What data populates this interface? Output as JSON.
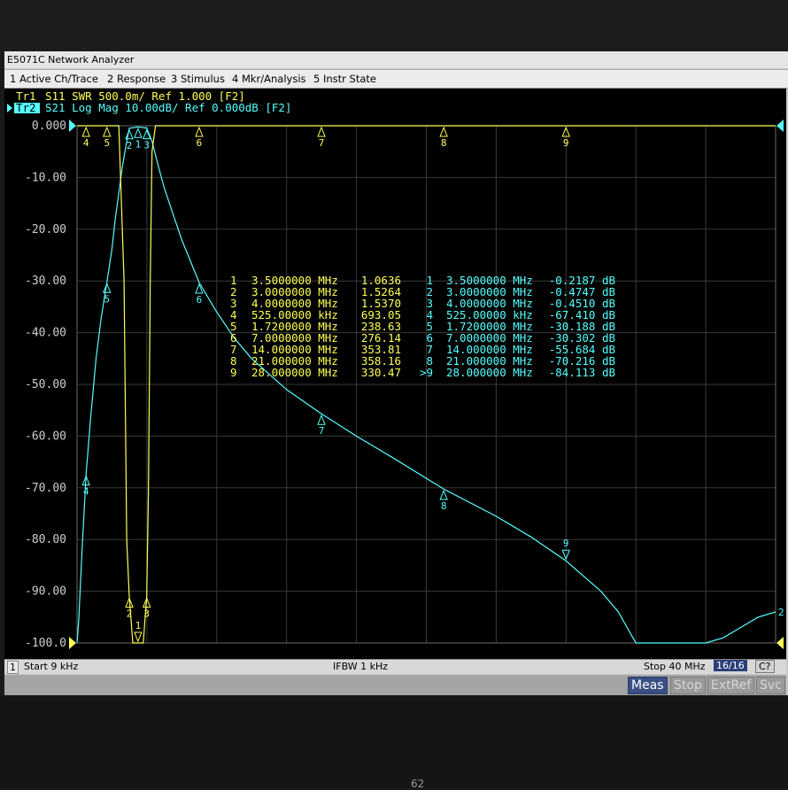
{
  "window": {
    "title": "E5071C Network Analyzer"
  },
  "menu": [
    {
      "label": "1 Active Ch/Trace"
    },
    {
      "label": "2 Response"
    },
    {
      "label": "3 Stimulus"
    },
    {
      "label": "4 Mkr/Analysis"
    },
    {
      "label": "5 Instr State"
    }
  ],
  "traces": [
    {
      "id": "Tr1",
      "text": "S11  SWR 500.0m/ Ref 1.000 [F2]",
      "color": "#ffff55",
      "active": false
    },
    {
      "id": "Tr2",
      "text": "S21  Log Mag 10.00dB/ Ref 0.000dB [F2]",
      "color": "#55ffff",
      "active": true
    }
  ],
  "axis": {
    "y_ticks": [
      "0.000",
      "-10.00",
      "-20.00",
      "-30.00",
      "-40.00",
      "-50.00",
      "-60.00",
      "-70.00",
      "-80.00",
      "-90.00",
      "-100.0"
    ]
  },
  "markers": {
    "s11": [
      {
        "n": "1",
        "freq": "3.5000000 MHz",
        "value": "1.0636"
      },
      {
        "n": "2",
        "freq": "3.0000000 MHz",
        "value": "1.5264"
      },
      {
        "n": "3",
        "freq": "4.0000000 MHz",
        "value": "1.5370"
      },
      {
        "n": "4",
        "freq": "525.00000 kHz",
        "value": "693.05"
      },
      {
        "n": "5",
        "freq": "1.7200000 MHz",
        "value": "238.63"
      },
      {
        "n": "6",
        "freq": "7.0000000 MHz",
        "value": "276.14"
      },
      {
        "n": "7",
        "freq": "14.000000 MHz",
        "value": "353.81"
      },
      {
        "n": "8",
        "freq": "21.000000 MHz",
        "value": "358.16"
      },
      {
        "n": "9",
        "freq": "28.000000 MHz",
        "value": "330.47"
      }
    ],
    "s21": [
      {
        "n": "1",
        "freq": "3.5000000 MHz",
        "value": "-0.2187 dB"
      },
      {
        "n": "2",
        "freq": "3.0000000 MHz",
        "value": "-0.4747 dB"
      },
      {
        "n": "3",
        "freq": "4.0000000 MHz",
        "value": "-0.4510 dB"
      },
      {
        "n": "4",
        "freq": "525.00000 kHz",
        "value": "-67.410 dB"
      },
      {
        "n": "5",
        "freq": "1.7200000 MHz",
        "value": "-30.188 dB"
      },
      {
        "n": "6",
        "freq": "7.0000000 MHz",
        "value": "-30.302 dB"
      },
      {
        "n": "7",
        "freq": "14.000000 MHz",
        "value": "-55.684 dB"
      },
      {
        "n": "8",
        "freq": "21.000000 MHz",
        "value": "-70.216 dB"
      },
      {
        "n": "9",
        "freq": "28.000000 MHz",
        "value": "-84.113 dB"
      }
    ],
    "active_prefix": ">"
  },
  "status": {
    "channel": "1",
    "start": "Start 9 kHz",
    "ifbw": "IFBW 1 kHz",
    "stop": "Stop 40 MHz",
    "count": "16/16",
    "mode": "C?"
  },
  "softkeys": [
    {
      "label": "Meas",
      "active": true
    },
    {
      "label": "Stop",
      "active": false
    },
    {
      "label": "ExtRef",
      "active": false
    },
    {
      "label": "Svc",
      "active": false
    }
  ],
  "photo": {
    "caption": "62"
  },
  "colors": {
    "trace_s11": "#ffff55",
    "trace_s21": "#55ffff",
    "grid": "#3a3a3a",
    "background": "#000000"
  },
  "chart_data": {
    "type": "line",
    "xlim": [
      0.009,
      40
    ],
    "xunit": "MHz",
    "ylim": [
      -100,
      0
    ],
    "yunit": "dB",
    "series": [
      {
        "name": "S21",
        "x": [
          0.009,
          0.1,
          0.3,
          0.525,
          0.8,
          1.1,
          1.4,
          1.72,
          2.0,
          2.2,
          2.4,
          2.6,
          2.8,
          3.0,
          3.5,
          4.0,
          4.3,
          4.6,
          5.0,
          5.5,
          6.0,
          7.0,
          8.0,
          9.0,
          10.0,
          12.0,
          14.0,
          16.0,
          18.0,
          21.0,
          24.0,
          26.0,
          28.0,
          30.0,
          31.0,
          32.0,
          33.0,
          34.0,
          35.0,
          36.0,
          37.0,
          38.0,
          39.0,
          40.0
        ],
        "y": [
          -100,
          -96,
          -82,
          -67.41,
          -56,
          -45,
          -37,
          -30.188,
          -24,
          -18,
          -13,
          -8,
          -4,
          -0.4747,
          -0.2187,
          -0.451,
          -3,
          -7,
          -12,
          -17,
          -22,
          -30.302,
          -36,
          -41,
          -45,
          -51,
          -55.684,
          -60,
          -64,
          -70.216,
          -75.5,
          -79.5,
          -84.113,
          -90,
          -94,
          -100,
          -100,
          -100,
          -100,
          -100,
          -99,
          -97,
          -95,
          -94
        ]
      },
      {
        "name": "S11",
        "x": [
          0.009,
          0.5,
          1.0,
          1.6,
          2.0,
          2.4,
          2.7,
          2.85,
          3.0,
          3.2,
          3.4,
          3.5,
          3.6,
          3.8,
          4.0,
          4.1,
          4.2,
          4.3,
          4.5,
          5.0,
          40.0
        ],
        "y": [
          0,
          0,
          0,
          0,
          0,
          0,
          -30,
          -80,
          -91,
          -100,
          -100,
          -100,
          -100,
          -100,
          -91,
          -70,
          -30,
          -5,
          0,
          0,
          0
        ]
      }
    ],
    "s11_markers": [
      {
        "n": "1",
        "x": 3.5,
        "y": -100
      },
      {
        "n": "2",
        "x": 3.0,
        "y": -91
      },
      {
        "n": "3",
        "x": 4.0,
        "y": -91
      },
      {
        "n": "4",
        "x": 0.525,
        "y": 0
      },
      {
        "n": "5",
        "x": 1.72,
        "y": 0
      },
      {
        "n": "6",
        "x": 7.0,
        "y": 0
      },
      {
        "n": "7",
        "x": 14.0,
        "y": 0
      },
      {
        "n": "8",
        "x": 21.0,
        "y": 0
      },
      {
        "n": "9",
        "x": 28.0,
        "y": 0
      }
    ],
    "s21_markers": [
      {
        "n": "1",
        "x": 3.5,
        "y": -0.2187
      },
      {
        "n": "2",
        "x": 3.0,
        "y": -0.4747
      },
      {
        "n": "3",
        "x": 4.0,
        "y": -0.451
      },
      {
        "n": "4",
        "x": 0.525,
        "y": -67.41
      },
      {
        "n": "5",
        "x": 1.72,
        "y": -30.188
      },
      {
        "n": "6",
        "x": 7.0,
        "y": -30.302
      },
      {
        "n": "7",
        "x": 14.0,
        "y": -55.684
      },
      {
        "n": "8",
        "x": 21.0,
        "y": -70.216
      },
      {
        "n": "9",
        "x": 28.0,
        "y": -84.113
      }
    ],
    "trace_end_label": "2"
  }
}
